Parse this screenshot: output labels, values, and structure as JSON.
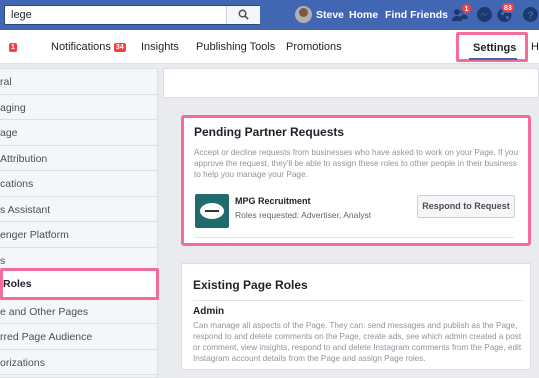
{
  "topbar": {
    "search_value": "lege",
    "user_name": "Steve",
    "home_label": "Home",
    "find_friends_label": "Find Friends",
    "friend_requests_badge": "1",
    "notifications_badge": "83",
    "bg_color": "#4267b2"
  },
  "tabs": {
    "items": [
      {
        "label": "",
        "badge": "1"
      },
      {
        "label": "Notifications",
        "badge": "34"
      },
      {
        "label": "Insights",
        "badge": ""
      },
      {
        "label": "Publishing Tools",
        "badge": ""
      },
      {
        "label": "Promotions",
        "badge": ""
      },
      {
        "label": "Settings",
        "badge": ""
      },
      {
        "label": "H",
        "badge": ""
      }
    ]
  },
  "sidebar": {
    "items": [
      {
        "label": "ral"
      },
      {
        "label": "aging"
      },
      {
        "label": "age"
      },
      {
        "label": "Attribution"
      },
      {
        "label": "cations"
      },
      {
        "label": "s Assistant"
      },
      {
        "label": "enger Platform"
      },
      {
        "label": "s"
      },
      {
        "label": "Roles"
      },
      {
        "label": "e and Other Pages"
      },
      {
        "label": "rred Page Audience"
      },
      {
        "label": "orizations"
      }
    ]
  },
  "pending": {
    "title": "Pending Partner Requests",
    "description": "Accept or decline requests from businesses who have asked to work on your Page. If you approve the request, they'll be able to assign these roles to other people in their business to help you manage your Page.",
    "request_name": "MPG Recruitment",
    "request_roles": "Roles requested: Advertiser, Analyst",
    "respond_label": "Respond to Request"
  },
  "existing": {
    "title": "Existing Page Roles",
    "admin_title": "Admin",
    "admin_description": "Can manage all aspects of the Page. They can: send messages and publish as the Page, respond to and delete comments on the Page, create ads, see which admin created a post or comment, view insights, respond to and delete Instagram comments from the Page, edit Instagram account details from the Page and assign Page roles."
  },
  "colors": {
    "highlight": "#f36c9c",
    "accent": "#4267b2",
    "badge": "#fa3e3e"
  }
}
